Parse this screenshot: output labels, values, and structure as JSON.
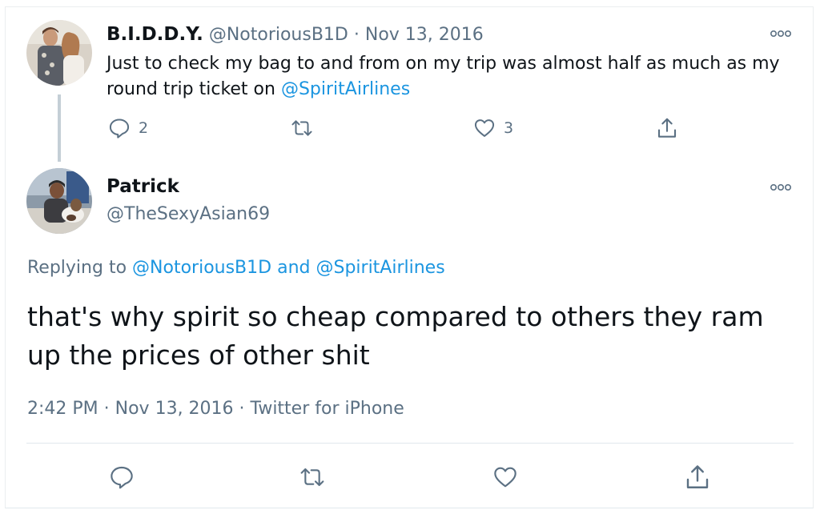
{
  "parent_tweet": {
    "display_name": "B.I.D.D.Y.",
    "handle": "@NotoriousB1D",
    "separator": "·",
    "date": "Nov 13, 2016",
    "text_before_mention": "Just to check my bag to and from on my trip was almost half as much as my round trip ticket on ",
    "mention": "@SpiritAirlines",
    "reply_count": "2",
    "like_count": "3",
    "icons": [
      "reply-icon",
      "retweet-icon",
      "like-icon",
      "share-icon",
      "more-icon"
    ]
  },
  "main_tweet": {
    "display_name": "Patrick",
    "handle": "@TheSexyAsian69",
    "replying_prefix": "Replying to ",
    "replying_user1": "@NotoriousB1D",
    "replying_and": " and ",
    "replying_user2": "@SpiritAirlines",
    "text": "that's why spirit so cheap compared to others they ram up the prices of other shit",
    "time": "2:42 PM",
    "separator1": " · ",
    "date": "Nov 13, 2016",
    "separator2": " · ",
    "source": "Twitter for iPhone",
    "icons": [
      "reply-icon",
      "retweet-icon",
      "like-icon",
      "share-icon",
      "more-icon"
    ]
  },
  "colors": {
    "link": "#1b95e0",
    "muted": "#5b7083",
    "text": "#0f1419",
    "thread_line": "#c4cfd6"
  }
}
